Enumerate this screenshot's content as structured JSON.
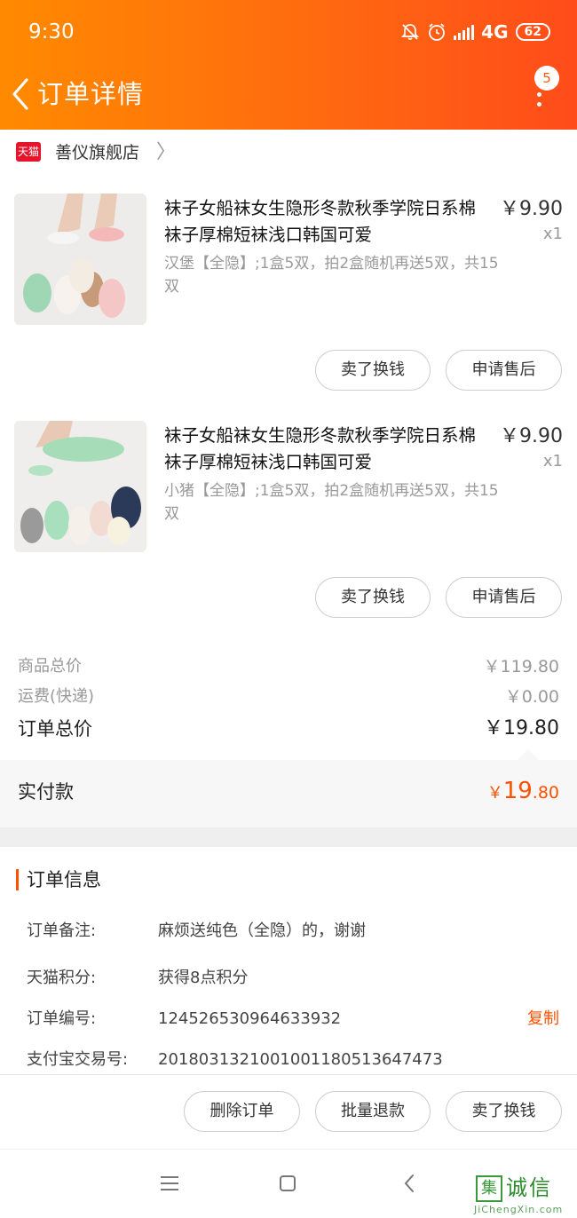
{
  "status_bar": {
    "time": "9:30",
    "network": "4G",
    "battery": "62"
  },
  "navbar": {
    "title": "订单详情",
    "badge": "5"
  },
  "store": {
    "logo_text": "天猫",
    "name": "善仪旗舰店"
  },
  "items": [
    {
      "title": "袜子女船袜女生隐形冬款秋季学院日系棉袜子厚棉短袜浅口韩国可爱",
      "price": "￥9.90",
      "qty": "x1",
      "sku": "汉堡【全隐】;1盒5双，拍2盒随机再送5双，共15双",
      "btn_sell": "卖了换钱",
      "btn_after": "申请售后"
    },
    {
      "title": "袜子女船袜女生隐形冬款秋季学院日系棉袜子厚棉短袜浅口韩国可爱",
      "price": "￥9.90",
      "qty": "x1",
      "sku": "小猪【全隐】;1盒5双，拍2盒随机再送5双，共15双",
      "btn_sell": "卖了换钱",
      "btn_after": "申请售后"
    }
  ],
  "summary": {
    "goods_label": "商品总价",
    "goods_value": "￥119.80",
    "shipping_label": "运费(快递)",
    "shipping_value": "￥0.00",
    "total_label": "订单总价",
    "total_value": "￥19.80"
  },
  "paid": {
    "label": "实付款",
    "currency": "￥",
    "int": "19",
    "dec": ".80"
  },
  "order_info": {
    "title": "订单信息",
    "rows": [
      {
        "key": "订单备注:",
        "value": "麻烦送纯色（全隐）的，谢谢"
      },
      {
        "key": "天猫积分:",
        "value": "获得8点积分"
      },
      {
        "key": "订单编号:",
        "value": "124526530964633932"
      },
      {
        "key": "支付宝交易号:",
        "value": "2018031321001001180513647473"
      }
    ],
    "copy_label": "复制"
  },
  "actions": {
    "delete": "删除订单",
    "refund": "批量退款",
    "sell": "卖了换钱"
  },
  "watermark": {
    "box": "集",
    "text": "诚信",
    "url": "JiChengXin.com"
  },
  "colors": {
    "header_start": "#ff8a00",
    "header_end": "#ff4c1a",
    "accent": "#ff5000"
  }
}
